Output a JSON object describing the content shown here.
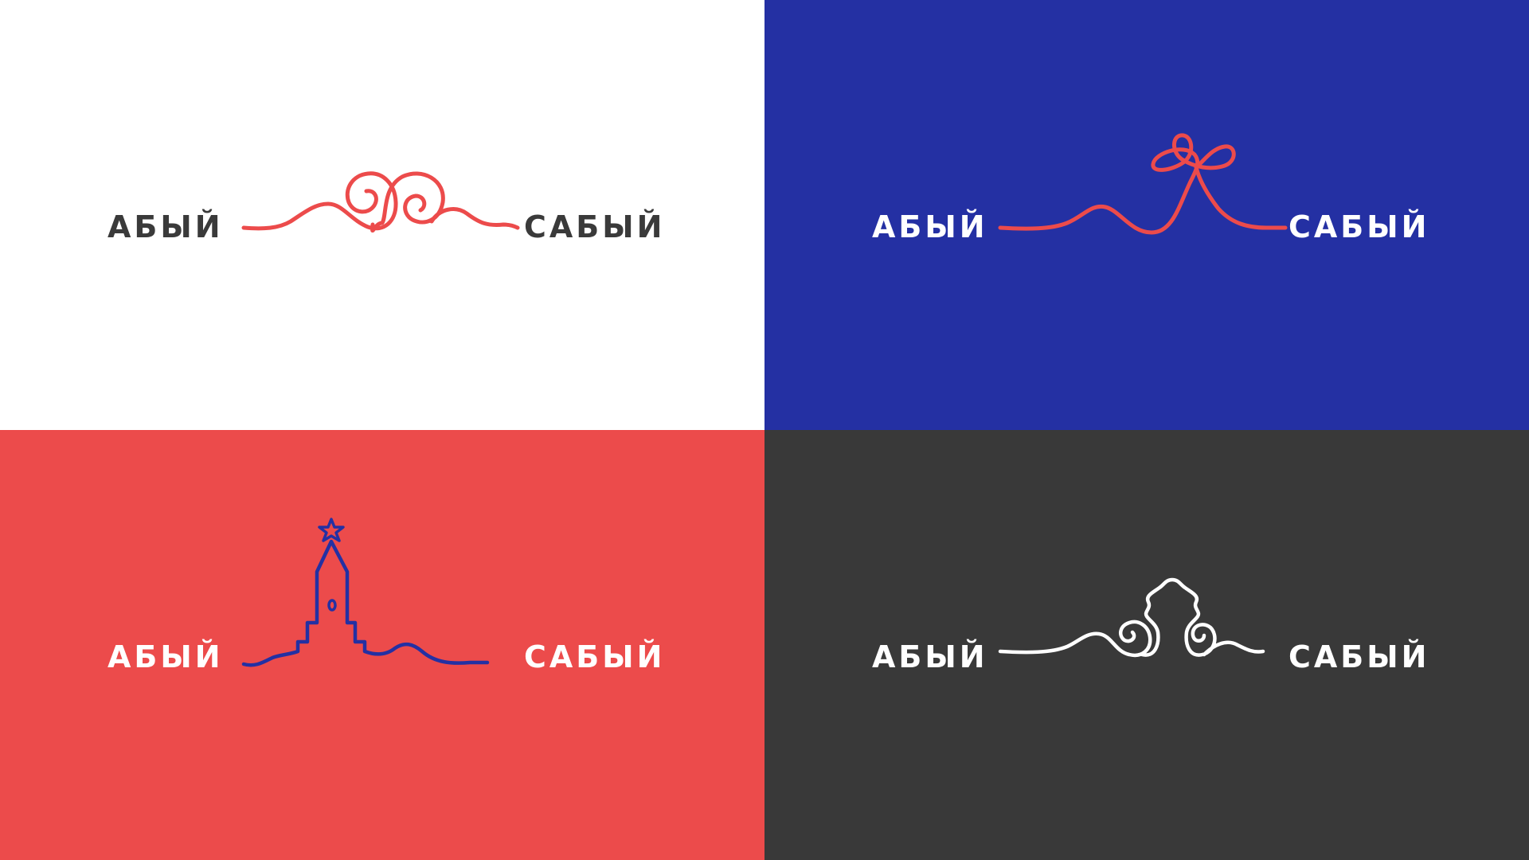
{
  "colors": {
    "white": "#ffffff",
    "blue": "#2430a3",
    "red": "#ec4b4b",
    "dark": "#393939",
    "text_dark": "#3a3a3a",
    "text_white": "#ffffff"
  },
  "panels": [
    {
      "id": "white",
      "left_word": "АБЫЙ",
      "right_word": "САБЫЙ",
      "background": "#ffffff",
      "text_color": "#3a3a3a",
      "line_color": "#ec4b4b",
      "motif": "double-spiral-icon"
    },
    {
      "id": "blue",
      "left_word": "АБЫЙ",
      "right_word": "САБЫЙ",
      "background": "#2430a3",
      "text_color": "#ffffff",
      "line_color": "#ec4b4b",
      "motif": "knot-bow-icon"
    },
    {
      "id": "red",
      "left_word": "АБЫЙ",
      "right_word": "САБЫЙ",
      "background": "#ec4b4b",
      "text_color": "#ffffff",
      "line_color": "#2430a3",
      "motif": "kremlin-tower-icon"
    },
    {
      "id": "dark",
      "left_word": "АБЫЙ",
      "right_word": "САБЫЙ",
      "background": "#393939",
      "text_color": "#ffffff",
      "line_color": "#ffffff",
      "motif": "chak-chak-icon"
    }
  ]
}
